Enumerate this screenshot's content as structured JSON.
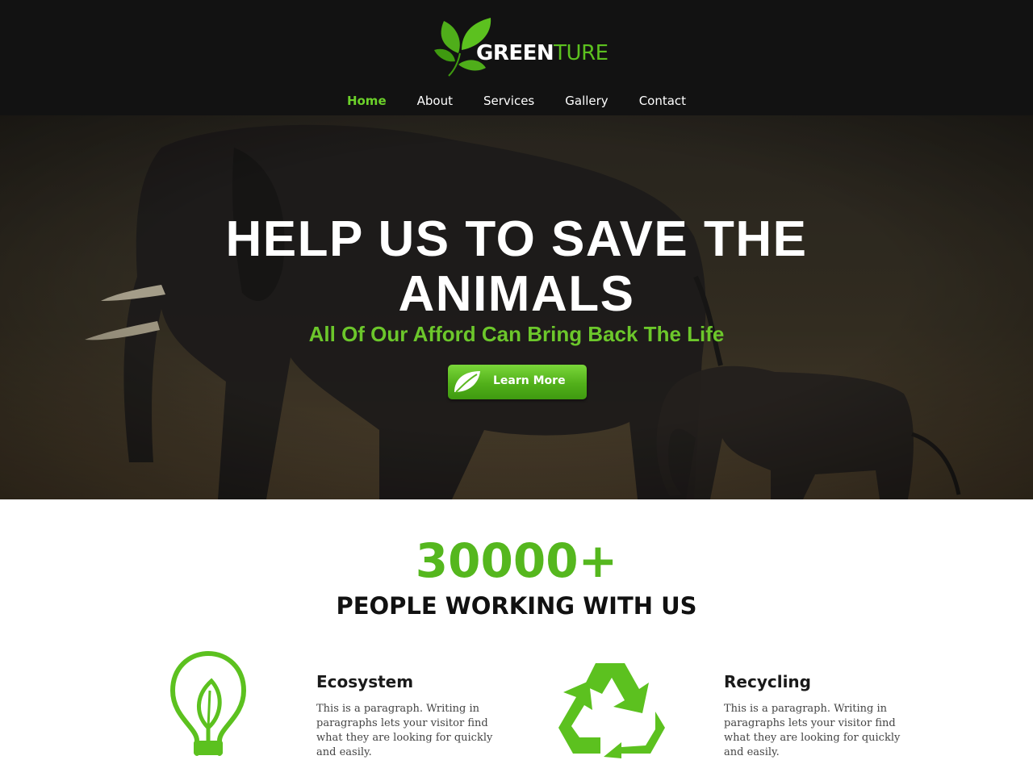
{
  "brand": {
    "name_part1": "GREEN",
    "name_part2": "TURE",
    "accent_color": "#5cc11f",
    "icon": "leaves-logo-icon"
  },
  "nav": {
    "items": [
      {
        "label": "Home",
        "active": true
      },
      {
        "label": "About",
        "active": false
      },
      {
        "label": "Services",
        "active": false
      },
      {
        "label": "Gallery",
        "active": false
      },
      {
        "label": "Contact",
        "active": false
      }
    ]
  },
  "hero": {
    "title": "HELP US TO SAVE THE ANIMALS",
    "subtitle": "All Of Our Afford Can Bring Back The Life",
    "button_label": "Learn More",
    "button_icon": "leaf-icon",
    "background": "elephants-photo"
  },
  "stats": {
    "number": "30000+",
    "label": "PEOPLE WORKING WITH US"
  },
  "features": [
    {
      "icon": "lightbulb-leaf-icon",
      "title": "Ecosystem",
      "text": "This is a paragraph. Writing in paragraphs lets your visitor find what they are looking for quickly and easily."
    },
    {
      "icon": "recycle-icon",
      "title": "Recycling",
      "text": "This is a paragraph. Writing in paragraphs lets your visitor find what they are looking for quickly and easily."
    }
  ]
}
